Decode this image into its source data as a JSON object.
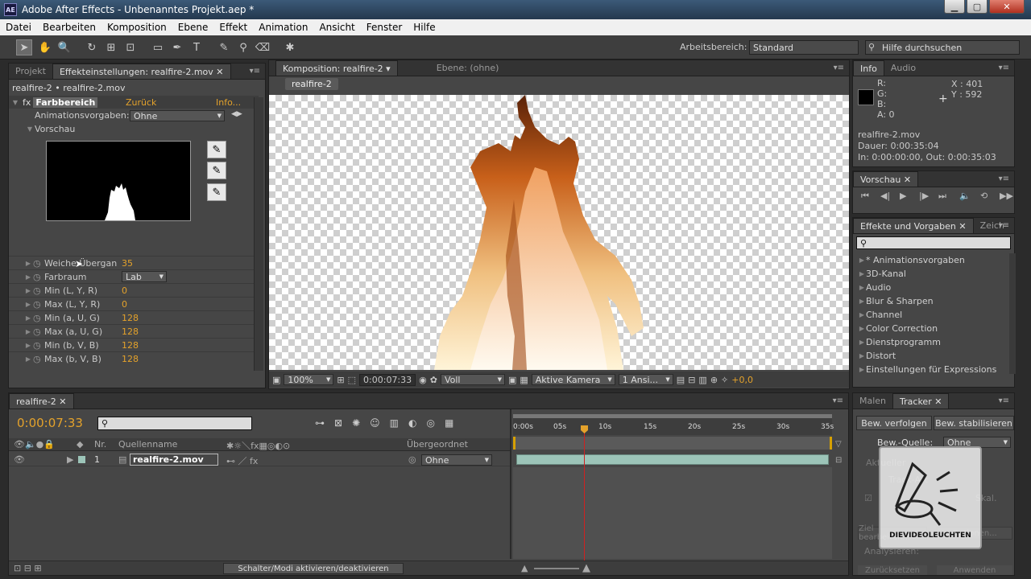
{
  "window": {
    "title": "Adobe After Effects - Unbenanntes Projekt.aep *",
    "app_icon": "AE"
  },
  "menu": [
    "Datei",
    "Bearbeiten",
    "Komposition",
    "Ebene",
    "Effekt",
    "Animation",
    "Ansicht",
    "Fenster",
    "Hilfe"
  ],
  "toolbar": {
    "workspace_label": "Arbeitsbereich:",
    "workspace_value": "Standard",
    "help_placeholder": "Hilfe durchsuchen"
  },
  "effects_panel": {
    "tabs": [
      "Projekt",
      "Effekteinstellungen: realfire-2.mov"
    ],
    "header": "realfire-2 • realfire-2.mov",
    "effect_name": "Farbbereich",
    "back_link": "Zurück",
    "info_link": "Info...",
    "preset_label": "Animationsvorgaben:",
    "preset_value": "Ohne",
    "preview_label": "Vorschau",
    "params": [
      {
        "name": "Weiche Übergan",
        "value": "35"
      },
      {
        "name": "Farbraum",
        "value": "Lab"
      },
      {
        "name": "Min (L, Y, R)",
        "value": "0"
      },
      {
        "name": "Max (L, Y, R)",
        "value": "0"
      },
      {
        "name": "Min (a, U, G)",
        "value": "128"
      },
      {
        "name": "Max (a, U, G)",
        "value": "128"
      },
      {
        "name": "Min (b, V, B)",
        "value": "128"
      },
      {
        "name": "Max (b, V, B)",
        "value": "128"
      }
    ]
  },
  "comp_panel": {
    "tabs": [
      "Komposition: realfire-2",
      "Ebene: (ohne)"
    ],
    "breadcrumb": "realfire-2",
    "zoom": "100%",
    "timecode": "0:00:07:33",
    "resolution": "Voll",
    "camera": "Aktive Kamera",
    "views": "1 Ansi...",
    "exposure": "+0,0"
  },
  "info_panel": {
    "tabs": [
      "Info",
      "Audio"
    ],
    "r": "R:",
    "g": "G:",
    "b": "B:",
    "a": "A:  0",
    "x": "X : 401",
    "y": "Y : 592",
    "file": "realfire-2.mov",
    "duration": "Dauer: 0:00:35:04",
    "inout": "In: 0:00:00:00, Out: 0:00:35:03"
  },
  "preview_panel": {
    "tab": "Vorschau"
  },
  "fx_presets_panel": {
    "tabs": [
      "Effekte und Vorgaben",
      "Zeich"
    ],
    "items": [
      "* Animationsvorgaben",
      "3D-Kanal",
      "Audio",
      "Blur & Sharpen",
      "Channel",
      "Color Correction",
      "Dienstprogramm",
      "Distort",
      "Einstellungen für Expressions"
    ]
  },
  "timeline": {
    "tab": "realfire-2",
    "timecode": "0:00:07:33",
    "col_nr": "Nr.",
    "col_source": "Quellenname",
    "col_parent": "Übergeordnet",
    "layer_num": "1",
    "layer_name": "realfire-2.mov",
    "layer_parent": "Ohne",
    "ruler": [
      "0:00s",
      "05s",
      "10s",
      "15s",
      "20s",
      "25s",
      "30s",
      "35s"
    ],
    "toggle_label": "Schalter/Modi aktivieren/deaktivieren"
  },
  "tracker_panel": {
    "tabs": [
      "Malen",
      "Tracker"
    ],
    "btn_track": "Bew. verfolgen",
    "btn_stab": "Bew. stabilisieren",
    "source_label": "Bew.-Quelle:",
    "source_value": "Ohne",
    "current_label": "Aktueller",
    "track_type": "Track-Art",
    "skal": "Skal.",
    "btn_target": "Ziel bearbeiten...",
    "btn_options": "Optionen...",
    "analyze": "Analysieren:",
    "btn_reset": "Zurücksetzen",
    "btn_apply": "Anwenden",
    "watermark": "DIEVIDEOLEUCHTEN"
  },
  "colors": {
    "accent_orange": "#e4a22b",
    "playhead": "#d02020",
    "layer_bar": "#9cc4b8"
  }
}
